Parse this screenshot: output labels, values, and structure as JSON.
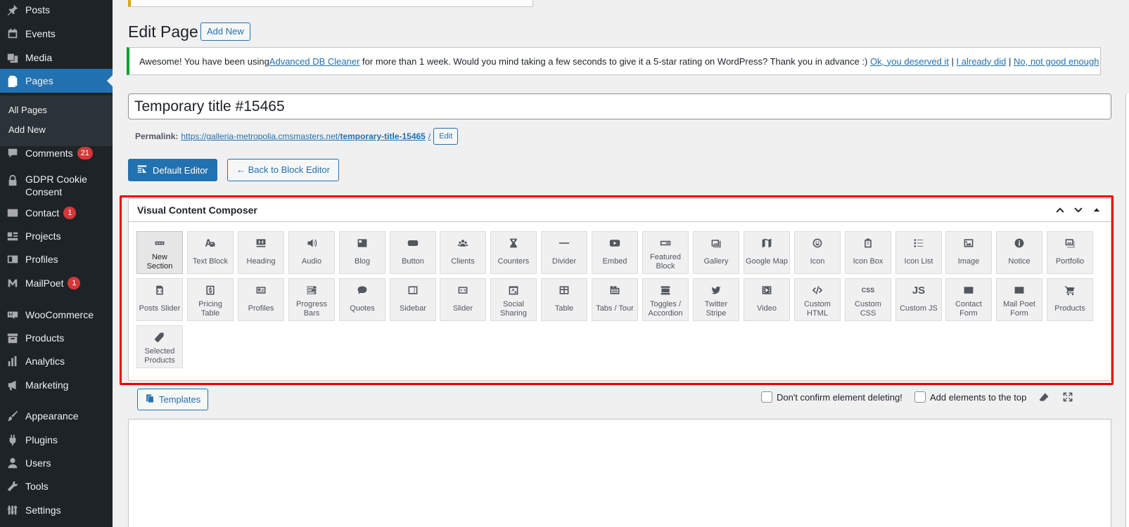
{
  "sidebar": {
    "items": [
      {
        "label": "Posts",
        "icon": "pin-icon",
        "name": "sidebar-item-posts"
      },
      {
        "label": "Events",
        "icon": "calendar-icon",
        "name": "sidebar-item-events"
      },
      {
        "label": "Media",
        "icon": "media-icon",
        "name": "sidebar-item-media"
      },
      {
        "label": "Pages",
        "icon": "pages-icon",
        "name": "sidebar-item-pages",
        "active": true
      },
      {
        "label": "Comments",
        "icon": "comment-icon",
        "name": "sidebar-item-comments",
        "badge": "21"
      },
      {
        "label": "GDPR Cookie Consent",
        "icon": "lock-icon",
        "name": "sidebar-item-gdpr"
      },
      {
        "label": "Contact",
        "icon": "mail-icon",
        "name": "sidebar-item-contact",
        "badge": "1"
      },
      {
        "label": "Projects",
        "icon": "projects-icon",
        "name": "sidebar-item-projects"
      },
      {
        "label": "Profiles",
        "icon": "profiles-icon",
        "name": "sidebar-item-profiles"
      },
      {
        "label": "MailPoet",
        "icon": "mailpoet-icon",
        "name": "sidebar-item-mailpoet",
        "badge": "1"
      },
      {
        "label": "WooCommerce",
        "icon": "woo-icon",
        "name": "sidebar-item-woocommerce"
      },
      {
        "label": "Products",
        "icon": "archive-icon",
        "name": "sidebar-item-products"
      },
      {
        "label": "Analytics",
        "icon": "bar-chart-icon",
        "name": "sidebar-item-analytics"
      },
      {
        "label": "Marketing",
        "icon": "megaphone-icon",
        "name": "sidebar-item-marketing"
      },
      {
        "label": "Appearance",
        "icon": "brush-icon",
        "name": "sidebar-item-appearance"
      },
      {
        "label": "Plugins",
        "icon": "plug-icon",
        "name": "sidebar-item-plugins"
      },
      {
        "label": "Users",
        "icon": "user-icon",
        "name": "sidebar-item-users"
      },
      {
        "label": "Tools",
        "icon": "wrench-icon",
        "name": "sidebar-item-tools"
      },
      {
        "label": "Settings",
        "icon": "settings-icon",
        "name": "sidebar-item-settings"
      }
    ],
    "submenu": [
      "All Pages",
      "Add New"
    ]
  },
  "header": {
    "title": "Edit Page",
    "add_new": "Add New"
  },
  "notice": {
    "text": "Awesome! You have been using ",
    "plugin_link": "Advanced DB Cleaner",
    "text2": " for more than 1 week. Would you mind taking a few seconds to give it a 5-star rating on WordPress? Thank you in advance :) ",
    "link1": "Ok, you deserved it",
    "sep": " | ",
    "link2": "I already did",
    "link3": "No, not good enough"
  },
  "post": {
    "title": "Temporary title #15465",
    "permalink_label": "Permalink:",
    "permalink_base": "https://galleria-metropolia.cmsmasters.net/",
    "permalink_slug": "temporary-title-15465",
    "permalink_end": "/",
    "edit_label": "Edit"
  },
  "editor_buttons": {
    "default_editor": "Default Editor",
    "back": "← Back to Block Editor"
  },
  "composer": {
    "title": "Visual Content Composer",
    "elements": [
      {
        "label": "New Section",
        "icon": "section-icon"
      },
      {
        "label": "Text Block",
        "icon": "text-icon"
      },
      {
        "label": "Heading",
        "icon": "heading-icon"
      },
      {
        "label": "Audio",
        "icon": "audio-icon"
      },
      {
        "label": "Blog",
        "icon": "blog-icon"
      },
      {
        "label": "Button",
        "icon": "button-icon"
      },
      {
        "label": "Clients",
        "icon": "clients-icon"
      },
      {
        "label": "Counters",
        "icon": "hourglass-icon"
      },
      {
        "label": "Divider",
        "icon": "divider-icon"
      },
      {
        "label": "Embed",
        "icon": "embed-icon"
      },
      {
        "label": "Featured Block",
        "icon": "featured-block-icon"
      },
      {
        "label": "Gallery",
        "icon": "gallery-icon"
      },
      {
        "label": "Google Map",
        "icon": "map-icon"
      },
      {
        "label": "Icon",
        "icon": "smiley-icon"
      },
      {
        "label": "Icon Box",
        "icon": "clipboard-icon"
      },
      {
        "label": "Icon List",
        "icon": "list-icon"
      },
      {
        "label": "Image",
        "icon": "image-icon"
      },
      {
        "label": "Notice",
        "icon": "info-icon"
      },
      {
        "label": "Portfolio",
        "icon": "portfolio-icon"
      },
      {
        "label": "Posts Slider",
        "icon": "posts-slider-icon"
      },
      {
        "label": "Pricing Table",
        "icon": "dollar-icon"
      },
      {
        "label": "Profiles",
        "icon": "profile-card-icon"
      },
      {
        "label": "Progress Bars",
        "icon": "progress-icon"
      },
      {
        "label": "Quotes",
        "icon": "quote-icon"
      },
      {
        "label": "Sidebar",
        "icon": "sidebar-icon"
      },
      {
        "label": "Slider",
        "icon": "slider-icon"
      },
      {
        "label": "Social Sharing",
        "icon": "share-icon"
      },
      {
        "label": "Table",
        "icon": "table-icon"
      },
      {
        "label": "Tabs / Tour",
        "icon": "tabs-icon"
      },
      {
        "label": "Toggles / Accordion",
        "icon": "accordion-icon"
      },
      {
        "label": "Twitter Stripe",
        "icon": "twitter-icon"
      },
      {
        "label": "Video",
        "icon": "video-icon"
      },
      {
        "label": "Custom HTML",
        "icon": "code-icon"
      },
      {
        "label": "Custom CSS",
        "icon": "css-icon"
      },
      {
        "label": "Custom JS",
        "icon": "js-icon"
      },
      {
        "label": "Contact Form",
        "icon": "envelope-icon"
      },
      {
        "label": "Mail Poet Form",
        "icon": "envelope-icon"
      },
      {
        "label": "Products",
        "icon": "cart-icon"
      },
      {
        "label": "Selected Products",
        "icon": "tag-icon"
      }
    ]
  },
  "toolbar": {
    "templates": "Templates",
    "confirm_delete": "Don't confirm element deleting!",
    "add_top": "Add elements to the top"
  },
  "icon_text": {
    "css": "CSS",
    "js": "JS"
  }
}
